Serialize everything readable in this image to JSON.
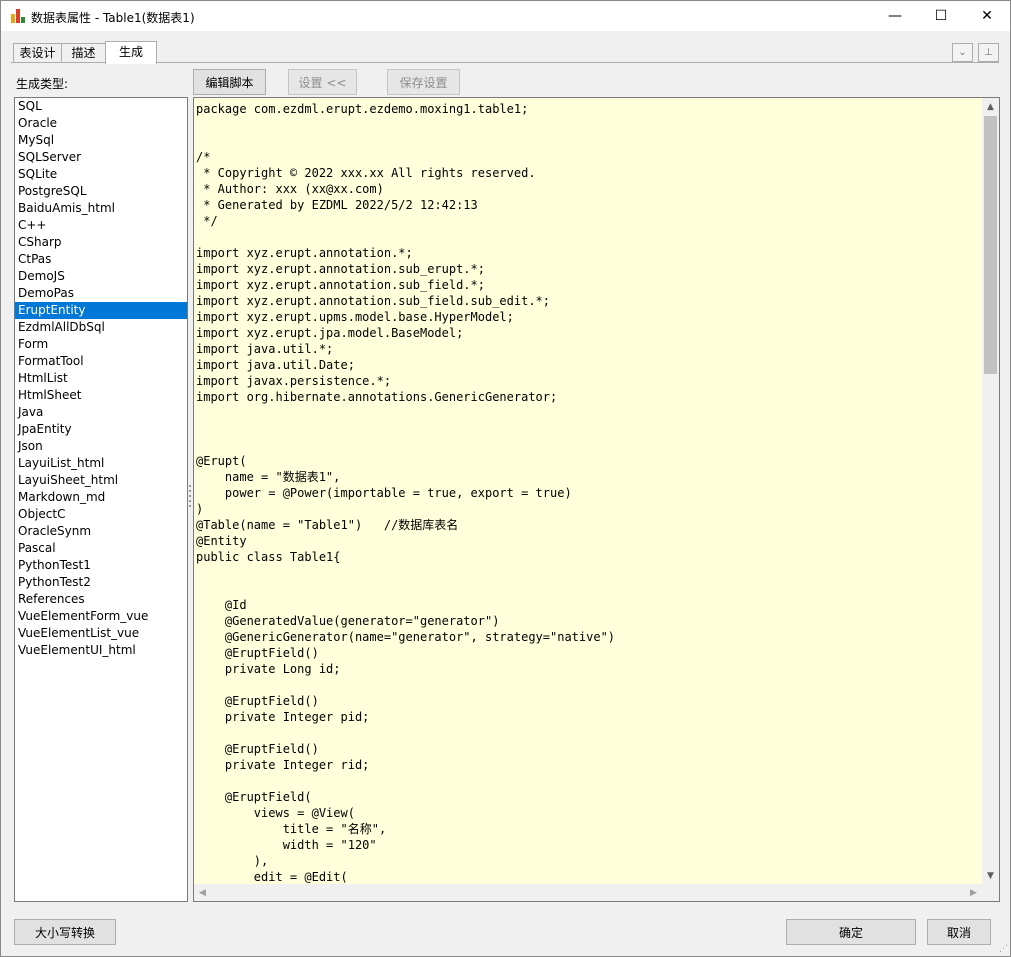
{
  "window": {
    "title": "数据表属性 - Table1(数据表1)",
    "minimize_glyph": "—",
    "maximize_glyph": "☐",
    "close_glyph": "✕"
  },
  "tabs": [
    "表设计",
    "描述",
    "生成"
  ],
  "active_tab": "生成",
  "tab_tools": {
    "dropdown_glyph": "⌄",
    "pin_glyph": "⊥"
  },
  "generate": {
    "type_label": "生成类型:",
    "types": [
      "SQL",
      "Oracle",
      "MySql",
      "SQLServer",
      "SQLite",
      "PostgreSQL",
      "BaiduAmis_html",
      "C++",
      "CSharp",
      "CtPas",
      "DemoJS",
      "DemoPas",
      "EruptEntity",
      "EzdmlAllDbSql",
      "Form",
      "FormatTool",
      "HtmlList",
      "HtmlSheet",
      "Java",
      "JpaEntity",
      "Json",
      "LayuiList_html",
      "LayuiSheet_html",
      "Markdown_md",
      "ObjectC",
      "OracleSynm",
      "Pascal",
      "PythonTest1",
      "PythonTest2",
      "References",
      "VueElementForm_vue",
      "VueElementList_vue",
      "VueElementUI_html"
    ],
    "selected_type": "EruptEntity",
    "edit_script_button": "编辑脚本",
    "settings_button": "设置 <<",
    "save_settings_button": "保存设置",
    "code_lines": [
      "package com.ezdml.erupt.ezdemo.moxing1.table1;",
      "",
      "",
      "/*",
      " * Copyright © 2022 xxx.xx All rights reserved.",
      " * Author: xxx (xx@xx.com)",
      " * Generated by EZDML 2022/5/2 12:42:13",
      " */",
      "",
      "import xyz.erupt.annotation.*;",
      "import xyz.erupt.annotation.sub_erupt.*;",
      "import xyz.erupt.annotation.sub_field.*;",
      "import xyz.erupt.annotation.sub_field.sub_edit.*;",
      "import xyz.erupt.upms.model.base.HyperModel;",
      "import xyz.erupt.jpa.model.BaseModel;",
      "import java.util.*;",
      "import java.util.Date;",
      "import javax.persistence.*;",
      "import org.hibernate.annotations.GenericGenerator;",
      "",
      "",
      "",
      "@Erupt(",
      "    name = \"数据表1\",",
      "    power = @Power(importable = true, export = true)",
      ")",
      "@Table(name = \"Table1\")   //数据库表名",
      "@Entity",
      "public class Table1{",
      "",
      "",
      "    @Id",
      "    @GeneratedValue(generator=\"generator\")",
      "    @GenericGenerator(name=\"generator\", strategy=\"native\")",
      "    @EruptField()",
      "    private Long id;",
      "",
      "    @EruptField()",
      "    private Integer pid;",
      "",
      "    @EruptField()",
      "    private Integer rid;",
      "",
      "    @EruptField(",
      "        views = @View(",
      "            title = \"名称\",",
      "            width = \"120\"",
      "        ),",
      "        edit = @Edit("
    ]
  },
  "bottom": {
    "case_convert_button": "大小写转换",
    "ok_button": "确定",
    "cancel_button": "取消"
  },
  "colors": {
    "selection": "#0078d7",
    "editor_background": "#ffffdc",
    "window_background": "#f0f0f0"
  }
}
